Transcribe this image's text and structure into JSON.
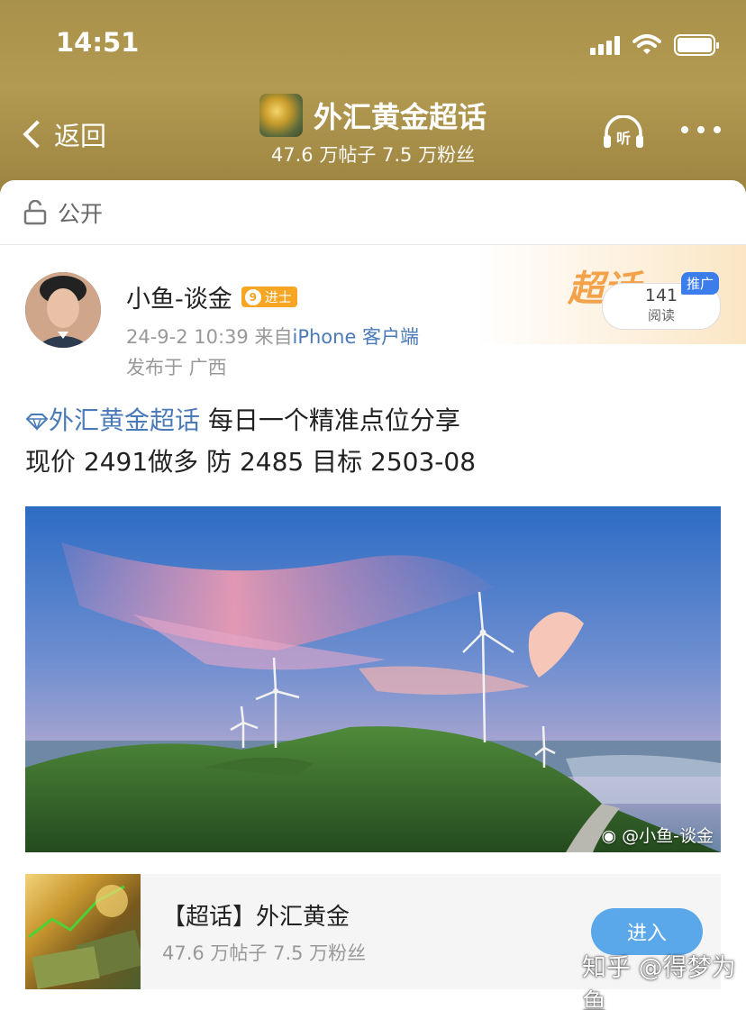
{
  "status": {
    "time": "14:51"
  },
  "header": {
    "back_label": "返回",
    "title": "外汇黄金超话",
    "subtitle": "47.6 万帖子 7.5 万粉丝",
    "listen_label": "听"
  },
  "visibility": {
    "label": "公开"
  },
  "post": {
    "author": "小鱼-谈金",
    "level_num": "9",
    "level_label": "进士",
    "date": "24-9-2 10:39",
    "from_prefix": "来自",
    "source": "iPhone 客户端",
    "location": "发布于 广西",
    "topic": "外汇黄金超话",
    "line1_rest": " 每日一个精准点位分享",
    "line2": "现价 2491做多 防 2485 目标 2503-08",
    "read_count": "141",
    "read_label": "阅读",
    "promo": "推广",
    "super_word": "超话",
    "image_watermark": "@小鱼-谈金"
  },
  "topic_card": {
    "name": "【超话】外汇黄金",
    "stats": "47.6 万帖子 7.5 万粉丝",
    "enter_label": "进入"
  },
  "bottom_watermark": "知乎 @得梦为鱼"
}
